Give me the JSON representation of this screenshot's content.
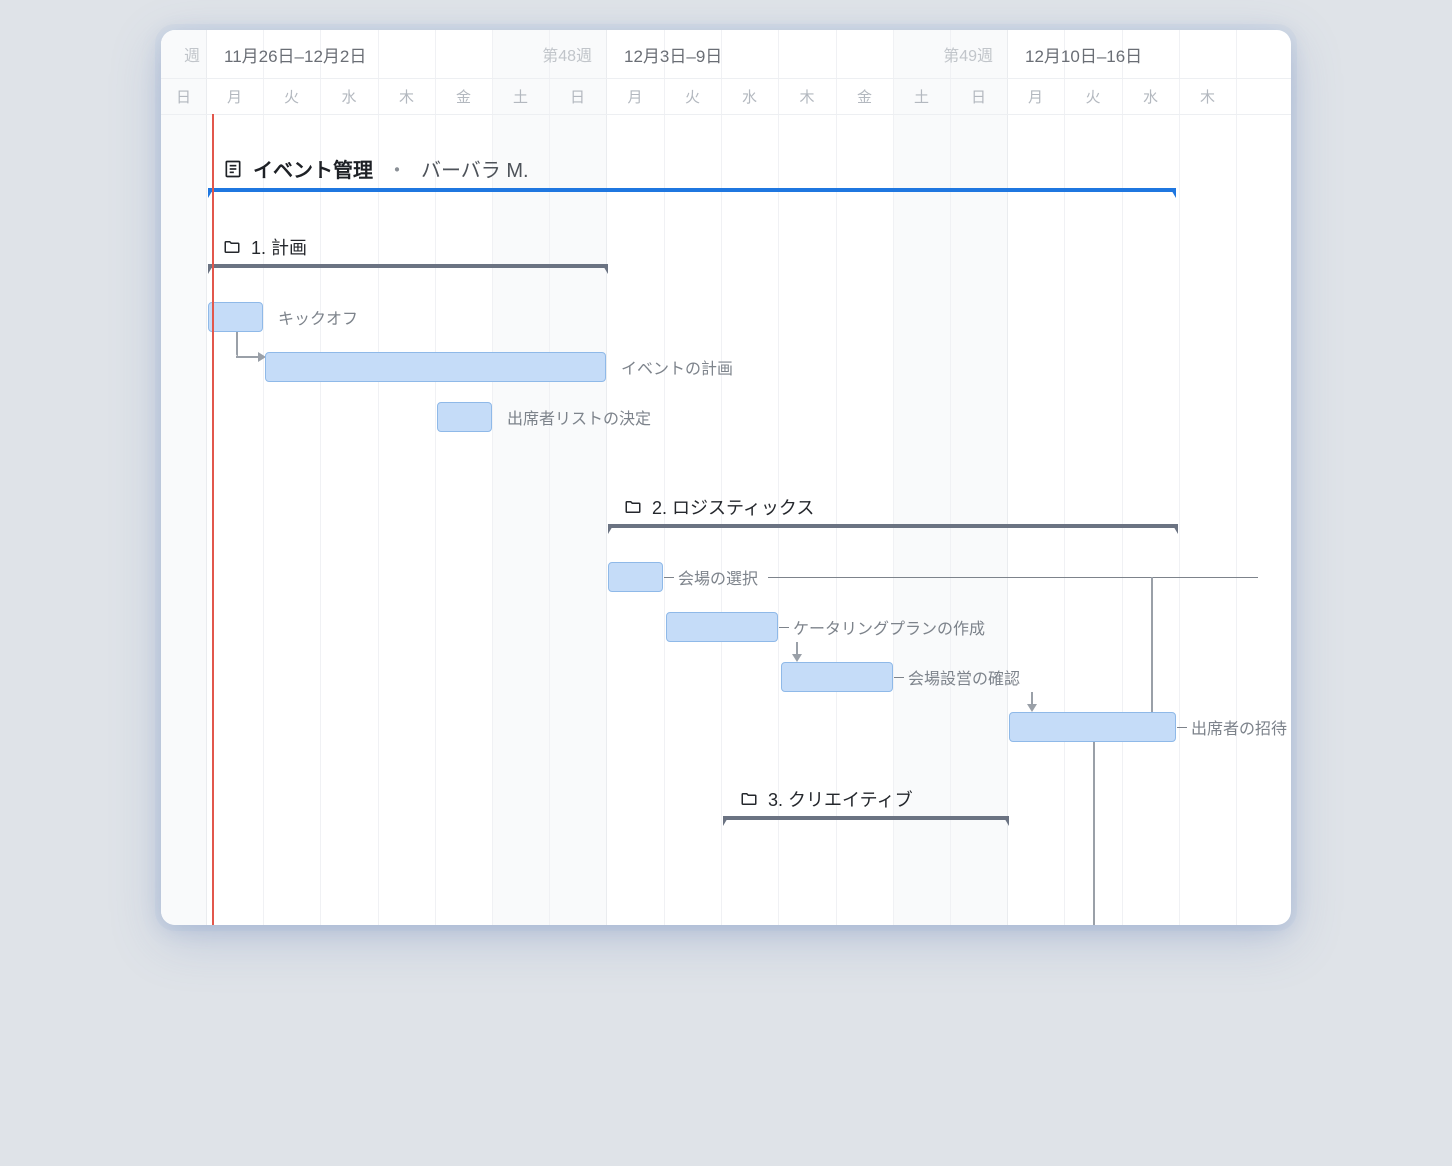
{
  "header": {
    "prev_week_label": "週",
    "weeks": [
      {
        "range": "11月26日–12月2日",
        "number": "第48週"
      },
      {
        "range": "12月3日–9日",
        "number": "第49週"
      },
      {
        "range": "12月10日–16日",
        "number": ""
      }
    ],
    "days": [
      "日",
      "月",
      "火",
      "水",
      "木",
      "金",
      "土",
      "日",
      "月",
      "火",
      "水",
      "木",
      "金",
      "土",
      "日",
      "月",
      "火",
      "水",
      "木"
    ]
  },
  "project": {
    "title": "イベント管理",
    "owner": "バーバラ M."
  },
  "groups": [
    {
      "name": "1. 計画"
    },
    {
      "name": "2. ロジスティックス"
    },
    {
      "name": "3. クリエイティブ"
    }
  ],
  "tasks": {
    "kickoff": "キックオフ",
    "plan_event": "イベントの計画",
    "attendee_list": "出席者リストの決定",
    "venue_select": "会場の選択",
    "catering": "ケータリングプランの作成",
    "setup_confirm": "会場設営の確認",
    "invite": "出席者の招待"
  },
  "chart_data": {
    "type": "gantt",
    "date_window": {
      "start": "2018-11-25",
      "end": "2018-12-13"
    },
    "time_unit": "day",
    "today_marker": "2018-11-26",
    "project": {
      "name": "イベント管理",
      "owner": "バーバラ M.",
      "start": "2018-11-26",
      "end": "2018-12-12"
    },
    "groups": [
      {
        "name": "1. 計画",
        "start": "2018-11-26",
        "end": "2018-12-02",
        "tasks": [
          {
            "id": "kickoff",
            "name": "キックオフ",
            "start": "2018-11-26",
            "end": "2018-11-26"
          },
          {
            "id": "plan_event",
            "name": "イベントの計画",
            "start": "2018-11-27",
            "end": "2018-12-02",
            "depends_on": [
              "kickoff"
            ]
          },
          {
            "id": "attendee_list",
            "name": "出席者リストの決定",
            "start": "2018-11-30",
            "end": "2018-11-30"
          }
        ]
      },
      {
        "name": "2. ロジスティックス",
        "start": "2018-12-02",
        "end": "2018-12-12",
        "tasks": [
          {
            "id": "venue_select",
            "name": "会場の選択",
            "start": "2018-12-03",
            "end": "2018-12-03",
            "depends_on": [
              "plan_event"
            ]
          },
          {
            "id": "catering",
            "name": "ケータリングプランの作成",
            "start": "2018-12-04",
            "end": "2018-12-05",
            "depends_on": [
              "venue_select"
            ]
          },
          {
            "id": "setup_confirm",
            "name": "会場設営の確認",
            "start": "2018-12-06",
            "end": "2018-12-07",
            "depends_on": [
              "catering"
            ]
          },
          {
            "id": "invite",
            "name": "出席者の招待",
            "start": "2018-12-10",
            "end": "2018-12-12",
            "depends_on": [
              "setup_confirm",
              "venue_select"
            ]
          }
        ]
      },
      {
        "name": "3. クリエイティブ",
        "start": "2018-12-05",
        "end": "2018-12-09",
        "tasks": []
      }
    ]
  }
}
